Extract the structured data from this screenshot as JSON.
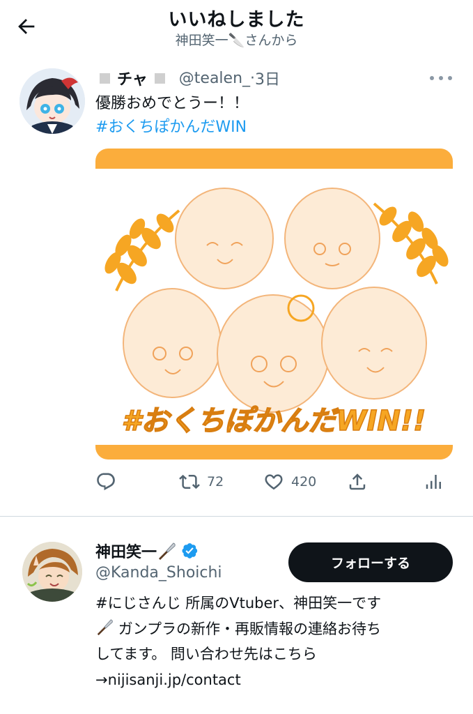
{
  "header": {
    "title": "いいねしました",
    "subtitle": "神田笑一🔪さんから"
  },
  "tweet": {
    "display_name": "チャ",
    "handle": "@tealen_",
    "time": "3日",
    "text": "優勝おめでとうー！！",
    "hashtag": "#おくちぽかんだWIN",
    "image_caption": "#おくちぽかんだWIN!!",
    "actions": {
      "retweets": "72",
      "likes": "420"
    }
  },
  "user": {
    "name": "神田笑一",
    "handle": "@Kanda_Shoichi",
    "follow_label": "フォローする",
    "bio": [
      "#にじさんじ 所属のVtuber、神田笑一です",
      "ガンプラの新作・再販情報の連絡お待ち",
      "してます。 問い合わせ先はこちら",
      "→nijisanji.jp/contact"
    ]
  },
  "colors": {
    "link": "#1d9bf0",
    "secondary_text": "#536471",
    "banner_orange": "#fbad3c",
    "verified_blue": "#1d9bf0"
  }
}
